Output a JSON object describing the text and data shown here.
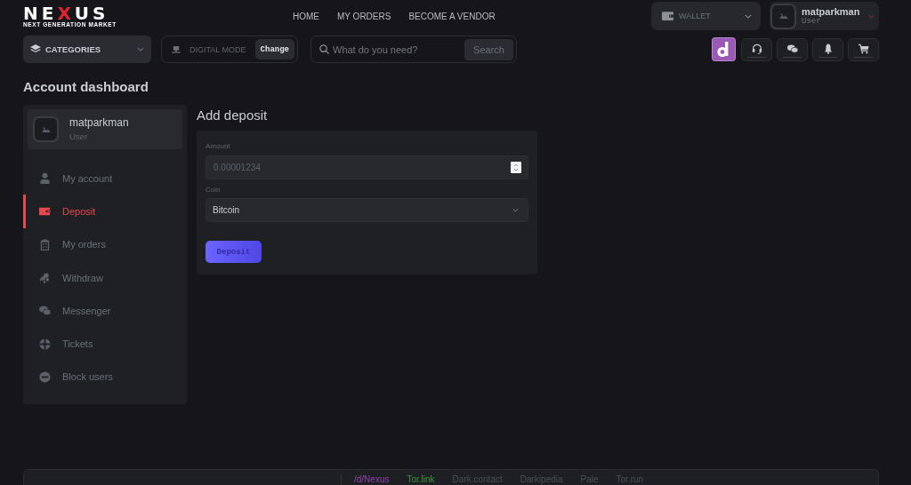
{
  "header": {
    "logo": {
      "wordmark": [
        {
          "text": "NE",
          "accent": false
        },
        {
          "text": "X",
          "accent": true
        },
        {
          "text": "US",
          "accent": false
        }
      ],
      "tagline": "NEXT GENERATION MARKET"
    },
    "nav": [
      {
        "label": "HOME"
      },
      {
        "label": "MY ORDERS"
      },
      {
        "label": "BECOME A VENDOR"
      }
    ],
    "wallet": {
      "label": "WALLET"
    },
    "user": {
      "name": "matparkman",
      "role": "User"
    }
  },
  "toolbar": {
    "categories": {
      "label": "CATEGORIES"
    },
    "mode": {
      "label": "DIGITAL MODE",
      "button": "Change"
    },
    "search": {
      "placeholder": "What do you need?",
      "button": "Search"
    }
  },
  "page_title": "Account dashboard",
  "sidebar": {
    "profile": {
      "name": "matparkman",
      "role": "User"
    },
    "items": [
      {
        "label": "My account",
        "selected": false
      },
      {
        "label": "Deposit",
        "selected": true
      },
      {
        "label": "My orders",
        "selected": false
      },
      {
        "label": "Withdraw",
        "selected": false
      },
      {
        "label": "Messenger",
        "selected": false
      },
      {
        "label": "Tickets",
        "selected": false
      },
      {
        "label": "Block users",
        "selected": false
      }
    ]
  },
  "deposit": {
    "title": "Add deposit",
    "fields": [
      {
        "kind": "number",
        "label": "Amount",
        "placeholder": "0.00001234"
      },
      {
        "kind": "select",
        "label": "Coin",
        "value": "Bitcoin"
      }
    ],
    "submit": "Deposit"
  },
  "footer": {
    "links": [
      {
        "label": "/d/Nexus",
        "color": "#8e44ad"
      },
      {
        "label": "Tor.link",
        "color": "#3a9a3a"
      },
      {
        "label": "Dark.contact",
        "color": "#4b4f57"
      },
      {
        "label": "Darkipedia",
        "color": "#4b4f57"
      },
      {
        "label": "Pale",
        "color": "#4b4f57"
      },
      {
        "label": "Tor.run",
        "color": "#4b4f57"
      }
    ]
  }
}
